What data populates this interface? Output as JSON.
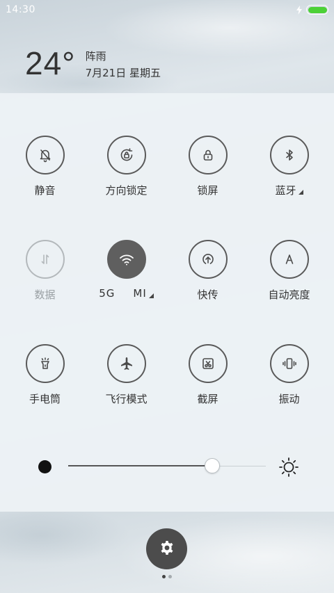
{
  "status_bar": {
    "time": "14:30",
    "battery_level": 1.0,
    "battery_color": "#4cd137"
  },
  "weather": {
    "temperature": "24°",
    "condition": "阵雨",
    "date": "7月21日 星期五"
  },
  "toggles": [
    {
      "label": "静音",
      "icon": "bell-off-icon",
      "state": "off"
    },
    {
      "label": "方向锁定",
      "icon": "rotation-lock-icon",
      "state": "off"
    },
    {
      "label": "锁屏",
      "icon": "lock-icon",
      "state": "off"
    },
    {
      "label": "蓝牙",
      "icon": "bluetooth-icon",
      "state": "off",
      "has_more": true
    },
    {
      "label": "数据",
      "icon": "data-arrows-icon",
      "state": "disabled"
    },
    {
      "label": "5G MI",
      "label_left": "5G",
      "label_right": "MI",
      "icon": "wifi-icon",
      "state": "on",
      "has_more": true
    },
    {
      "label": "快传",
      "icon": "quick-share-icon",
      "state": "off"
    },
    {
      "label": "自动亮度",
      "icon": "auto-brightness-icon",
      "state": "off"
    },
    {
      "label": "手电筒",
      "icon": "flashlight-icon",
      "state": "off"
    },
    {
      "label": "飞行模式",
      "icon": "airplane-icon",
      "state": "off"
    },
    {
      "label": "截屏",
      "icon": "screenshot-icon",
      "state": "off"
    },
    {
      "label": "振动",
      "icon": "vibrate-icon",
      "state": "off"
    }
  ],
  "brightness": {
    "level": 0.73,
    "min_icon": "dark-dot-icon",
    "max_icon": "sun-icon"
  },
  "settings": {
    "icon": "gear-icon"
  },
  "pager": {
    "pages": 2,
    "current": 1
  },
  "colors": {
    "active_toggle": "#5f5f5f",
    "settings_button": "#4c4c4c"
  }
}
